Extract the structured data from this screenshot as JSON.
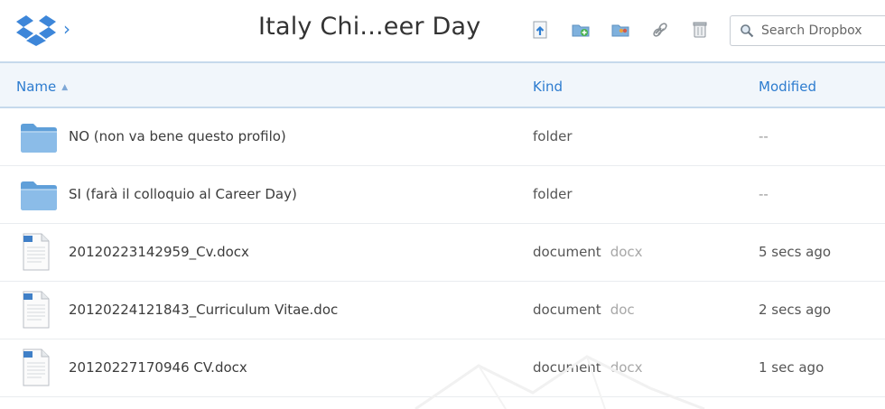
{
  "header": {
    "breadcrumb_chevron": "›",
    "title": "Italy Chi...eer Day",
    "toolbar": [
      {
        "name": "upload-icon"
      },
      {
        "name": "new-folder-icon"
      },
      {
        "name": "new-shared-folder-icon"
      },
      {
        "name": "get-link-icon"
      },
      {
        "name": "deleted-files-icon"
      }
    ],
    "search": {
      "placeholder": "Search Dropbox",
      "icon": "search-icon"
    }
  },
  "columns": {
    "name": "Name",
    "sort_indicator": "▲",
    "kind": "Kind",
    "modified": "Modified"
  },
  "files": [
    {
      "type": "folder",
      "name": "NO (non va bene questo profilo)",
      "kind": "folder",
      "ext": "",
      "modified": "--"
    },
    {
      "type": "folder",
      "name": "SI (farà il colloquio al Career Day)",
      "kind": "folder",
      "ext": "",
      "modified": "--"
    },
    {
      "type": "document",
      "name": "20120223142959_Cv.docx",
      "kind": "document",
      "ext": "docx",
      "modified": "5 secs ago"
    },
    {
      "type": "document",
      "name": "20120224121843_Curriculum Vitae.doc",
      "kind": "document",
      "ext": "doc",
      "modified": "2 secs ago"
    },
    {
      "type": "document",
      "name": "20120227170946 CV.docx",
      "kind": "document",
      "ext": "docx",
      "modified": "1 sec ago"
    }
  ],
  "colors": {
    "accent": "#2d7ccf",
    "header_bg": "#f1f6fb",
    "folder": "#6fa8dc"
  }
}
